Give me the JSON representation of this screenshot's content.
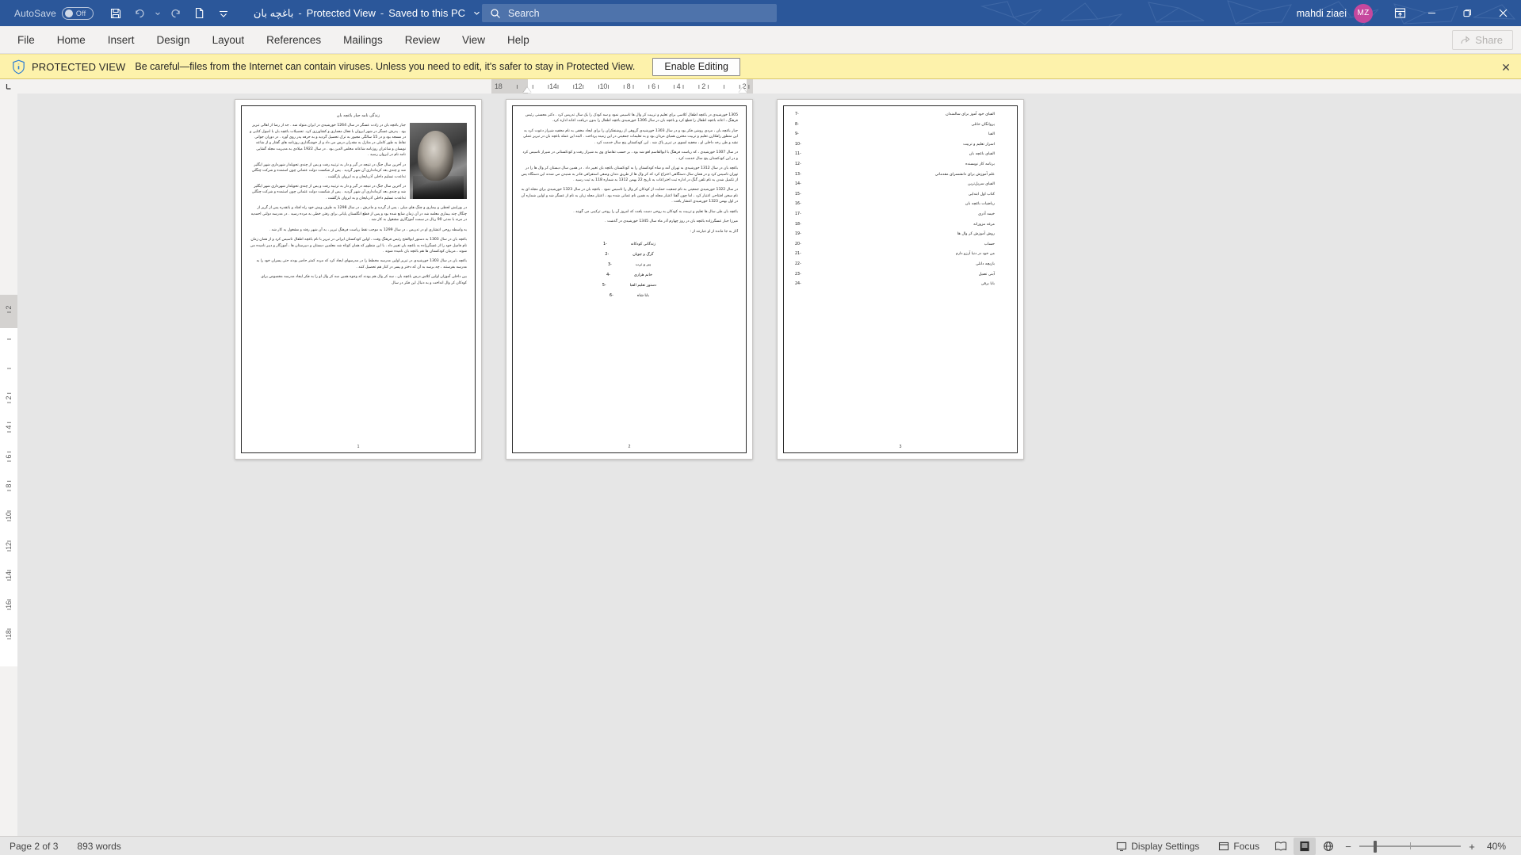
{
  "titlebar": {
    "autosave_label": "AutoSave",
    "autosave_state": "Off",
    "doc_title": "باغچه بان",
    "sep1": "-",
    "view_mode": "Protected View",
    "sep2": "-",
    "save_location": "Saved to this PC",
    "search_placeholder": "Search",
    "user_name": "mahdi ziaei",
    "user_initials": "MZ",
    "icons": {
      "save": "save-icon",
      "undo": "undo-icon",
      "redo": "redo-icon",
      "new": "new-document-icon",
      "qat_more": "customize-quick-access-toolbar-icon",
      "search": "search-icon",
      "ribbon_display": "ribbon-display-options-icon",
      "minimize": "minimize-icon",
      "restore": "restore-icon",
      "close": "close-icon"
    }
  },
  "ribbon": {
    "tabs": [
      {
        "label": "File"
      },
      {
        "label": "Home"
      },
      {
        "label": "Insert"
      },
      {
        "label": "Design"
      },
      {
        "label": "Layout"
      },
      {
        "label": "References"
      },
      {
        "label": "Mailings"
      },
      {
        "label": "Review"
      },
      {
        "label": "View"
      },
      {
        "label": "Help"
      }
    ],
    "share_label": "Share",
    "share_icon": "share-icon"
  },
  "protected_view": {
    "icon": "shield-info-icon",
    "title": "PROTECTED VIEW",
    "message": "Be careful—files from the Internet can contain viruses. Unless you need to edit, it's safer to stay in Protected View.",
    "enable_label": "Enable Editing",
    "close_icon": "close-icon",
    "close_glyph": "✕"
  },
  "rulers": {
    "tab_selector_icon": "left-tab-stop-icon",
    "horizontal_ticks": [
      "18",
      "ı",
      "ı",
      "ı14ı",
      "ı12ı",
      "ı10ı",
      "ı 8 ı",
      "ı 6 ı",
      "ı 4 ı",
      "ı 2 ı",
      "ı",
      "ı 2 ı"
    ],
    "vertical_ticks": [
      "ı 2",
      "ı",
      "ı",
      "ı 2 ı",
      "ı 4 ı",
      "ı 6 ı",
      "ı 8 ı",
      "ı10ı",
      "ı12ı",
      "ı14ı",
      "ı16ı",
      "ı18ı"
    ]
  },
  "document": {
    "pages": [
      {
        "page_number": "1",
        "type": "text",
        "title": "زندگی نامه جبار باغچه بان",
        "has_photo": true,
        "paragraphs": [
          "جبار باغچه بان در زادت عسگر در سال 1264 خورشیدی در ایران متولد شد . جد از رضا از اهالی تبریز بود . پدرش عسگر در شهر ایروان با فعال معماری و کشاورزی کرد. تحصیلات باغچه بان با اصول کتابی و در مسجد بود و در 15 سالگی مجبور به ترک تحصیل گردید و به حرفه پدر روی آورد . در دوران جوانی نقاط به طور کاملی در منازل به مقدران درس می داد و از خوشگذاری روزنامه های گفتار و از شاعه نویسان و شاعران روزنامه شاعانه مخلص الدین بود . در سال 1922 میلادی به مدیریت مجله گشایی نامه نام در ایروان رسید .",
          "در آخرین سال جنگ در نتیجه در گیر و دار به ترتیبه رفت و پس از چندی تحویلدار شهرداری شهر ایگلیر شد و چندی بعد کرمانداری آن شهر گردید . پس از شکست دولت عثمانی چون استمده و شرکت چنگلی تداعدت تسلیم داخلی آذربایجان و به ایروان بازگشت .",
          "در آخرین سال جنگ در نتیجه در گیر و دار به ترتیبه رفت و پس از چندی تحویلدار شهرداری شهر ایگلیر شد و چندی بعد کرمانداری آن شهر گردید . پس از شکست دولت عثمانی چون استمده و شرکت چنگلی تداعدت تسلیم داخلی آذربایجان و به ایروان بازگشت .",
          "در بورایش لحظی و بیماری و چنگ های میلی ، پس از گردید و مادرش ، در سال 1298 به طرف ویش خود راه افتاد و باتقدره پس از گریز از چنگال چند بیماری معلمه شد در آن زمان شایع شده بود و پس از قطع انگلستان پایانی برای رفتن خطی به مرده رسید . در مدرسه دولتی احمدیه در مرند با مدتی 90 ریال در سمت آموزگاری مشغول به کار شد .",
          "به واسطه روحی انتشاری او در تدریس ، در سال 1299 به موجب نقط ریاست فرهنگ تبریز ، به آن شهر رفته و مشغول به کار شد .",
          "باغچه بان در سال 1303 به دستور ابوالفتح رئیس فرهنگ وقت ، اولین کودکستان ایرانی در تبریز با نام باغچه اطفال تاسیس کرد و از همان زمان نام فامیل خود را از عسگرزاده به باغچه بان تغییر داد . با این منظور که همان کوتاه شد معلمین دبستان و دبیرستان ها ، آموزگار و دبیر نامیده می شوند ، مربیان کودکستان ها هم باغچه بان نامیده شوند .",
          "باغچه بان در سال 1303 خورشیدی در تبریز اولین مدرسه مخطط را در مدرسهای ایجاد کرد که مردد کمتر حاضر بودند حتی پسران خود را به مدرسه بفرستند ، چه برسد به آن که دختر و پسر در کنار هم تحصیل کنند .",
          "بین داخلی آموزان اولین کلاس درس باغچه بان ، سه کر وال هم بودند که وجوه همین سه کر وال او را به فکر ایجاد مدرسه مخصوص برای کودکان کر وال انداخت و به دنبال این فکر در سال"
        ]
      },
      {
        "page_number": "2",
        "type": "text",
        "paragraphs": [
          "1305 خورشیدی در باغچه اطفال کلاسی برای تعلیم و تربیت کر وال ها تاسیس نمود و سه کودک را یک سال تدریس کرد . دکتر محسنی رئیس فرهنگ ، اعانه باغچه اطفال را قطع کرد و باغچه بان در سال 1306 خورشیدی باغچه اطفال را بدون دریافت اعانه اداره کرد.",
          "جبار باغچه بان ، مردی روشن فکر بود و در سال 1303 خورشیدی گروهی از روشنفکران را برای ایجاد مخفی به نام مخفیه شیراز دعوت کرد به این منظور راهکارن تعلیم و تربیت مخترن همیای مردان بود و به تعلیمات جمعیتی در این زمینه پرداخت . البته این عمله باغچه بان در تبریز عملی نشد و طی رخد داخلی او ، مخفیه لسوی در تبریز پاک شد . این کودکستان پنج سال خدمت کرد .",
          "در سال 1307 خورشیدی ، که ریاست فرهنگ با ابوالقاسم لغو شد بود ، بر حسب تقاضای وی به شیراز رفت و کودکستانی در شیراز تاسیس کرد و در این کودکستان پنج سال خدمت کرد .",
          "باغچه بان در سال 1312 خورشیدی به تهران آمد و شاه کودکستان را به کودکستان باغچه بان تغییر داد . در همین سال دبستان کر وال ها را در تهران تاسیس کرد و در همان سال دستگاهی اختراع کرد که کر وال ها از طریق دندان وضعی استفراقی قادر به شنیدن می شدند این دستگاه پس از تکمیل شدن به نام تلفن گنگ در اداره ثبت اختراعات به تاریخ 22 بهمن 1312 به شماره 118 به ثبت رسید .",
          "در سال 1322 خورشیدی جمعیتی به نام جمعیت حمایت از کودکان کر وال را تاسیس نمود . باغچه بان در سال 1323 خورشیدی برای مجله ای به نام سخن افتتاحی اعتبار کرد ، اما چون گفتا اعتبار مجله ای به همین نام عمانی شده بود ، اعتبار مجله زبان به نام از عسگر شد و اولین شماره آن در اول بهمن 1323 خورشیدی انتشار یافت .",
          "باغچه بان طی سال ها تعلیم و تربیت به کودکان به روحی دست یافت که امروز آن را روحی ترکیبی می گویند .",
          "میرزا جبار عسگرزاده باغچه بان در روز چهارم آذر ماه سال 1345 خورشیدی در گذشت .",
          "آثار به جا مانده از او عبارتند از :"
        ],
        "numbered_list": [
          {
            "n": "1-",
            "t": "زندگانی کودکانه"
          },
          {
            "n": "2-",
            "t": "گرگ و چوپان"
          },
          {
            "n": "3-",
            "t": "پیر و ترب"
          },
          {
            "n": "4-",
            "t": "خانم هزاری"
          },
          {
            "n": "5-",
            "t": "دستور تعلیم الفبا"
          },
          {
            "n": "6-",
            "t": "بابا شاه"
          }
        ]
      },
      {
        "page_number": "3",
        "type": "toc",
        "entries": [
          {
            "n": "7-",
            "t": "الفبای خود آموز برای سالمندان"
          },
          {
            "n": "8-",
            "t": "پروانگان خانلی"
          },
          {
            "n": "9-",
            "t": "الفبا"
          },
          {
            "n": "10-",
            "t": "اسرار تعلیم و تربیت"
          },
          {
            "n": "11-",
            "t": "الفبای باغچه بان"
          },
          {
            "n": "12-",
            "t": "برنامه کار نویسنده"
          },
          {
            "n": "13-",
            "t": "علم آموزش برای دانشسرای مقدماتی"
          },
          {
            "n": "14-",
            "t": "الفبای سریل‌ترین"
          },
          {
            "n": "15-",
            "t": "کتاب اول ابتدایی"
          },
          {
            "n": "16-",
            "t": "ریاضیات باغچه بان"
          },
          {
            "n": "17-",
            "t": "خیمه آذری"
          },
          {
            "n": "18-",
            "t": "مرغه مزورانه"
          },
          {
            "n": "19-",
            "t": "روش آموزش کر وال ها"
          },
          {
            "n": "20-",
            "t": "حساب"
          },
          {
            "n": "21-",
            "t": "من خود در دنیا آرزو دارم"
          },
          {
            "n": "22-",
            "t": "بازیچه دانلی"
          },
          {
            "n": "23-",
            "t": "آبنی تصیل"
          },
          {
            "n": "24-",
            "t": "بابا برقی"
          }
        ]
      }
    ]
  },
  "statusbar": {
    "page_indicator": "Page 2 of 3",
    "word_count": "893 words",
    "display_settings": "Display Settings",
    "focus": "Focus",
    "display_settings_icon": "display-settings-icon",
    "focus_icon": "focus-icon",
    "view_read_icon": "read-mode-icon",
    "view_print_icon": "print-layout-icon",
    "view_web_icon": "web-layout-icon",
    "zoom_out_glyph": "−",
    "zoom_in_glyph": "+",
    "zoom_level": "40%"
  }
}
